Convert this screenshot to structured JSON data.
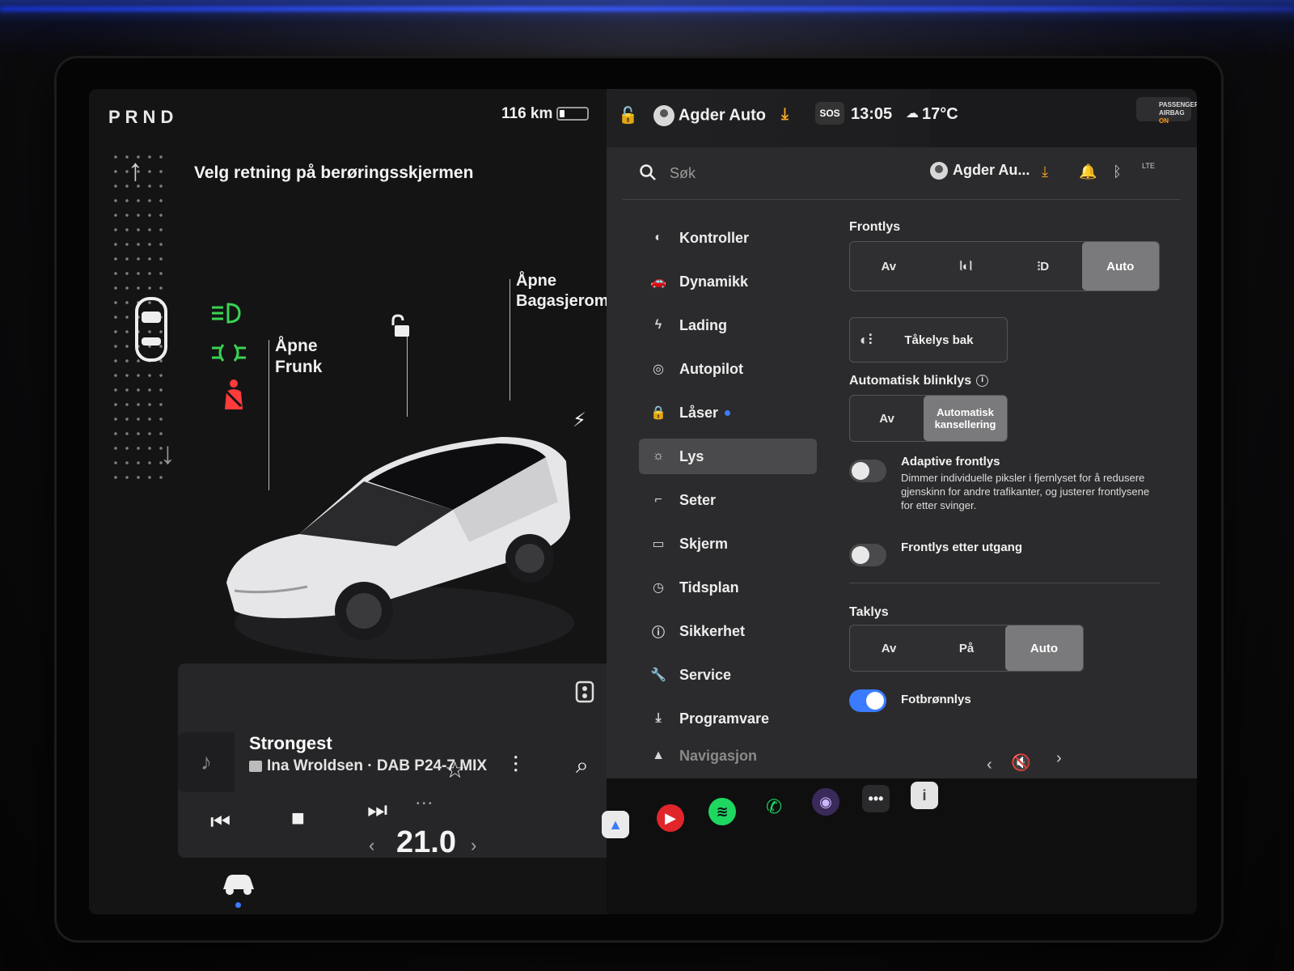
{
  "drive": {
    "gears": "PRND",
    "range": "116 km",
    "battery_percent": 20,
    "instruction": "Velg retning på berøringsskjermen"
  },
  "car_view": {
    "frunk_label_1": "Åpne",
    "frunk_label_2": "Frunk",
    "trunk_label_1": "Åpne",
    "trunk_label_2": "Bagasjerom"
  },
  "media": {
    "song": "Strongest",
    "artist_line": "Ina Wroldsen · DAB P24-7 MIX"
  },
  "climate": {
    "temperature": "21.0"
  },
  "status_bar": {
    "profile": "Agder Auto",
    "sos": "SOS",
    "time": "13:05",
    "outside_temp": "17°C",
    "airbag_line1": "PASSENGER",
    "airbag_line2": "AIRBAG",
    "airbag_state": "ON"
  },
  "settings": {
    "search_placeholder": "Søk",
    "profile_short": "Agder Au...",
    "lte": "LTE",
    "menu": [
      {
        "label": "Kontroller",
        "icon": "toggle-icon"
      },
      {
        "label": "Dynamikk",
        "icon": "car-icon"
      },
      {
        "label": "Lading",
        "icon": "bolt-icon"
      },
      {
        "label": "Autopilot",
        "icon": "steering-wheel-icon"
      },
      {
        "label": "Låser",
        "icon": "lock-icon"
      },
      {
        "label": "Lys",
        "icon": "sun-icon"
      },
      {
        "label": "Seter",
        "icon": "seat-icon"
      },
      {
        "label": "Skjerm",
        "icon": "display-icon"
      },
      {
        "label": "Tidsplan",
        "icon": "clock-icon"
      },
      {
        "label": "Sikkerhet",
        "icon": "alert-icon"
      },
      {
        "label": "Service",
        "icon": "wrench-icon"
      },
      {
        "label": "Programvare",
        "icon": "download-icon"
      },
      {
        "label": "Navigasjon",
        "icon": "navigation-icon"
      }
    ],
    "active_menu": "Lys",
    "headlights": {
      "title": "Frontlys",
      "options": [
        "Av",
        "",
        "",
        "Auto"
      ],
      "selected": "Auto"
    },
    "rear_fog": "Tåkelys bak",
    "auto_blinker": {
      "title": "Automatisk blinklys",
      "options": [
        "Av",
        "Automatisk kansellering"
      ],
      "selected": "Automatisk kansellering"
    },
    "adaptive": {
      "title": "Adaptive frontlys",
      "desc": "Dimmer individuelle piksler i fjernlyset for å redusere gjenskinn for andre trafikanter, og justerer frontlysene for etter svinger.",
      "on": false
    },
    "follow_me": {
      "title": "Frontlys etter utgang",
      "on": false
    },
    "dome": {
      "title": "Taklys",
      "options": [
        "Av",
        "På",
        "Auto"
      ],
      "selected": "Auto"
    },
    "footwell": {
      "title": "Fotbrønnlys",
      "on": true
    }
  },
  "colors": {
    "accent_blue": "#3a7bff",
    "indicator_green": "#39d353",
    "indicator_red": "#ff3b3b",
    "download_orange": "#f5a623"
  }
}
